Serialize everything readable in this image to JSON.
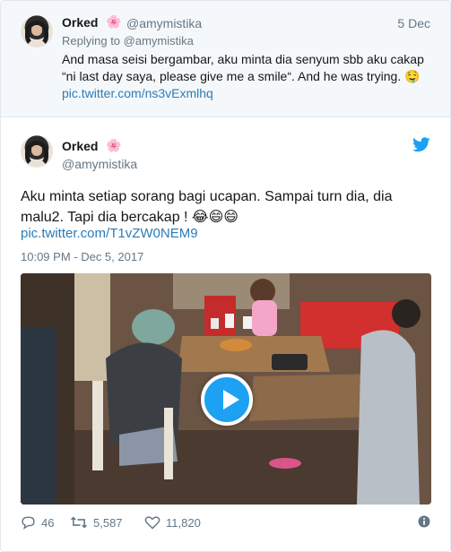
{
  "parent_tweet": {
    "name": "Orked",
    "name_emoji": "🌸",
    "handle": "@amymistika",
    "date": "5 Dec",
    "replying_prefix": "Replying to",
    "replying_to": "@amymistika",
    "text": "And masa seisi bergambar, aku minta dia senyum sbb aku cakap “ni last day saya, please give me a smile“. And he was trying. 🤤",
    "link": "pic.twitter.com/ns3vExmlhq"
  },
  "main_tweet": {
    "name": "Orked",
    "name_emoji": "🌸",
    "handle": "@amymistika",
    "text": "Aku minta setiap sorang bagi ucapan. Sampai turn dia, dia malu2. Tapi dia bercakap ! 😂😄😄",
    "link": "pic.twitter.com/T1vZW0NEM9",
    "timestamp": "10:09 PM - Dec 5, 2017"
  },
  "actions": {
    "replies": "46",
    "retweets": "5,587",
    "likes": "11,820"
  },
  "icons": {
    "logo": "twitter-bird-icon",
    "reply": "reply-icon",
    "retweet": "retweet-icon",
    "like": "heart-icon",
    "info": "info-icon",
    "play": "play-icon"
  },
  "colors": {
    "brand": "#1da1f2",
    "link": "#2b7bb9",
    "muted": "#657786",
    "text": "#14171a",
    "parent_background": "#f5f8fa"
  }
}
